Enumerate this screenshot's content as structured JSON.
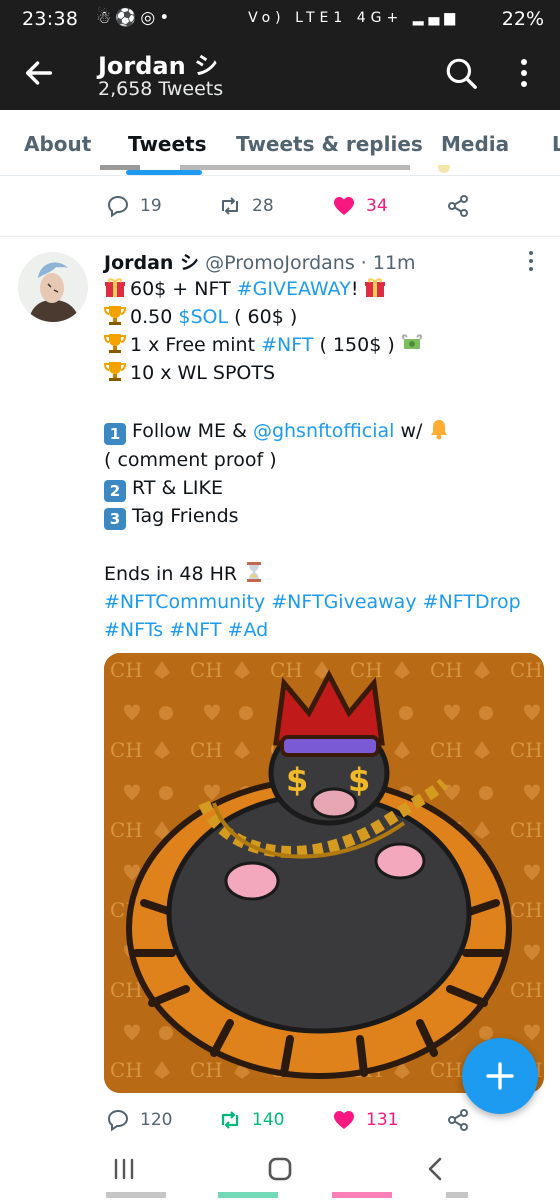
{
  "status_bar": {
    "time": "23:38",
    "battery": "22%",
    "network": "4G+",
    "volte": "Vo) LTE1"
  },
  "header": {
    "title": "Jordan シ",
    "subtitle": "2,658 Tweets"
  },
  "tabs": [
    {
      "label": "About"
    },
    {
      "label": "Tweets",
      "active": true
    },
    {
      "label": "Tweets & replies"
    },
    {
      "label": "Media"
    },
    {
      "label": "L"
    }
  ],
  "previous_tweet": {
    "replies": "19",
    "retweets": "28",
    "likes": "34"
  },
  "tweet": {
    "name": "Jordan シ",
    "handle": "@PromoJordans",
    "time": "· 11m",
    "lines": {
      "l1_a": "60$ + NFT ",
      "l1_link": "#GIVEAWAY",
      "l1_b": "!",
      "l2_a": "0.50 ",
      "l2_link": "$SOL",
      "l2_b": " ( 60$ )",
      "l3_a": "1 x Free mint ",
      "l3_link": "#NFT",
      "l3_b": " ( 150$ )",
      "l4": "10 x WL SPOTS",
      "l5_a": "Follow ME & ",
      "l5_link": "@ghsnftofficial",
      "l5_b": " w/",
      "l6": "( comment proof )",
      "l7": "RT & LIKE",
      "l8": "Tag Friends",
      "l9": "Ends in 48 HR",
      "l10_a": "#NFTCommunity",
      "l10_b": "#NFTGiveaway",
      "l10_c": "#NFTDrop",
      "l11_a": "#NFTs",
      "l11_b": "#NFT",
      "l11_c": "#Ad"
    },
    "keycaps": [
      "1",
      "2",
      "3"
    ],
    "media_watermark": "CH",
    "replies": "120",
    "retweets": "140",
    "likes": "131"
  },
  "icons": [
    "back-arrow-icon",
    "search-icon",
    "more-vertical-icon",
    "reply-icon",
    "retweet-icon",
    "heart-icon",
    "share-icon",
    "compose-icon",
    "recent-apps-icon",
    "home-icon",
    "back-icon"
  ],
  "colors": {
    "accent": "#1d9bf0",
    "like": "#f91880",
    "retweet": "#00ba7c",
    "muted": "#536471",
    "header_bg": "#1d1d1d"
  }
}
